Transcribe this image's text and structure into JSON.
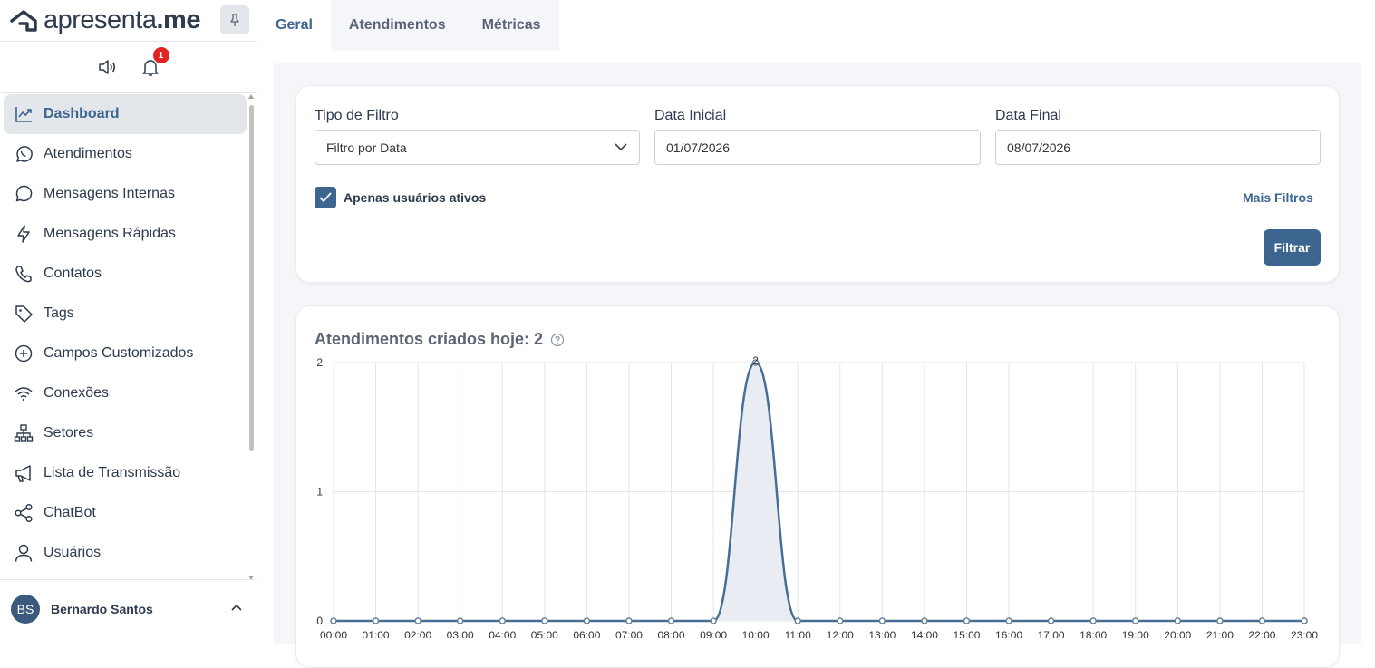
{
  "brand": {
    "name_prefix": "apresenta",
    "name_suffix": ".me"
  },
  "notifications": {
    "badge_count": "1"
  },
  "sidebar": {
    "items": [
      {
        "label": "Dashboard",
        "icon": "chart-line-icon",
        "active": true
      },
      {
        "label": "Atendimentos",
        "icon": "whatsapp-icon"
      },
      {
        "label": "Mensagens Internas",
        "icon": "chat-bubble-icon"
      },
      {
        "label": "Mensagens Rápidas",
        "icon": "lightning-icon"
      },
      {
        "label": "Contatos",
        "icon": "phone-icon"
      },
      {
        "label": "Tags",
        "icon": "tag-icon"
      },
      {
        "label": "Campos Customizados",
        "icon": "plus-circle-icon"
      },
      {
        "label": "Conexões",
        "icon": "wifi-icon"
      },
      {
        "label": "Setores",
        "icon": "org-chart-icon"
      },
      {
        "label": "Lista de Transmissão",
        "icon": "megaphone-icon"
      },
      {
        "label": "ChatBot",
        "icon": "share-nodes-icon"
      },
      {
        "label": "Usuários",
        "icon": "user-icon"
      }
    ]
  },
  "user": {
    "initials": "BS",
    "name": "Bernardo Santos"
  },
  "tabs": [
    {
      "label": "Geral",
      "active": true
    },
    {
      "label": "Atendimentos"
    },
    {
      "label": "Métricas"
    }
  ],
  "filters": {
    "type_label": "Tipo de Filtro",
    "type_value": "Filtro por Data",
    "start_label": "Data Inicial",
    "start_value": "01/07/2026",
    "end_label": "Data Final",
    "end_value": "08/07/2026",
    "active_users_label": "Apenas usuários ativos",
    "active_users_checked": true,
    "more_filters": "Mais Filtros",
    "submit": "Filtrar"
  },
  "colors": {
    "accent": "#3c6590",
    "line": "#476f96",
    "fill": "#e9edf3"
  },
  "chart_data": {
    "type": "area",
    "title": "Atendimentos criados hoje: 2",
    "x": [
      "00:00",
      "01:00",
      "02:00",
      "03:00",
      "04:00",
      "05:00",
      "06:00",
      "07:00",
      "08:00",
      "09:00",
      "10:00",
      "11:00",
      "12:00",
      "13:00",
      "14:00",
      "15:00",
      "16:00",
      "17:00",
      "18:00",
      "19:00",
      "20:00",
      "21:00",
      "22:00",
      "23:00"
    ],
    "values": [
      0,
      0,
      0,
      0,
      0,
      0,
      0,
      0,
      0,
      0,
      2,
      0,
      0,
      0,
      0,
      0,
      0,
      0,
      0,
      0,
      0,
      0,
      0,
      0
    ],
    "yticks": [
      0,
      1,
      2
    ],
    "ylim": [
      0,
      2
    ],
    "grid": true,
    "data_labels": [
      "2"
    ]
  }
}
